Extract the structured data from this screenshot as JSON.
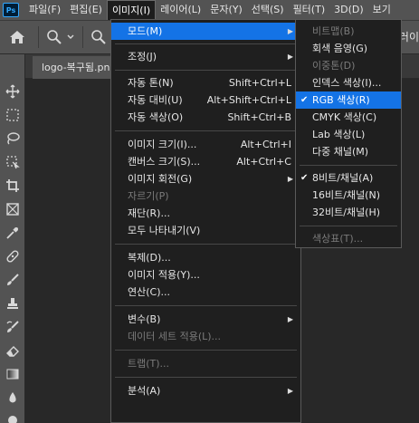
{
  "app": {
    "logo_text": "Ps"
  },
  "menubar": {
    "items": [
      {
        "label": "파일(F)"
      },
      {
        "label": "편집(E)"
      },
      {
        "label": "이미지(I)"
      },
      {
        "label": "레이어(L)"
      },
      {
        "label": "문자(Y)"
      },
      {
        "label": "선택(S)"
      },
      {
        "label": "필터(T)"
      },
      {
        "label": "3D(D)"
      },
      {
        "label": "보기"
      }
    ],
    "active_index": 2
  },
  "options": {
    "right_text": "러이"
  },
  "document_tab": {
    "title": "logo-복구됨.pn"
  },
  "image_menu": {
    "items": [
      {
        "label": "모드(M)",
        "submenu": true,
        "highlighted": true
      },
      {
        "label": "조정(J)",
        "submenu": true
      },
      {
        "label": "자동 톤(N)",
        "shortcut": "Shift+Ctrl+L"
      },
      {
        "label": "자동 대비(U)",
        "shortcut": "Alt+Shift+Ctrl+L"
      },
      {
        "label": "자동 색상(O)",
        "shortcut": "Shift+Ctrl+B"
      },
      {
        "label": "이미지 크기(I)...",
        "shortcut": "Alt+Ctrl+I"
      },
      {
        "label": "캔버스 크기(S)...",
        "shortcut": "Alt+Ctrl+C"
      },
      {
        "label": "이미지 회전(G)",
        "submenu": true
      },
      {
        "label": "자르기(P)",
        "disabled": true
      },
      {
        "label": "재단(R)..."
      },
      {
        "label": "모두 나타내기(V)"
      },
      {
        "label": "복제(D)..."
      },
      {
        "label": "이미지 적용(Y)..."
      },
      {
        "label": "연산(C)..."
      },
      {
        "label": "변수(B)",
        "submenu": true
      },
      {
        "label": "데이터 세트 적용(L)...",
        "disabled": true
      },
      {
        "label": "트랩(T)...",
        "disabled": true
      },
      {
        "label": "분석(A)",
        "submenu": true
      }
    ]
  },
  "mode_submenu": {
    "items": [
      {
        "label": "비트맵(B)",
        "disabled": true
      },
      {
        "label": "회색 음영(G)"
      },
      {
        "label": "이중톤(D)",
        "disabled": true
      },
      {
        "label": "인덱스 색상(I)..."
      },
      {
        "label": "RGB 색상(R)",
        "checked": true,
        "highlighted": true
      },
      {
        "label": "CMYK 색상(C)"
      },
      {
        "label": "Lab 색상(L)"
      },
      {
        "label": "다중 채널(M)"
      },
      {
        "label": "8비트/채널(A)",
        "checked": true
      },
      {
        "label": "16비트/채널(N)"
      },
      {
        "label": "32비트/채널(H)"
      },
      {
        "label": "색상표(T)...",
        "disabled": true
      }
    ]
  },
  "colors": {
    "highlight": "#1473e6",
    "menu_bg": "#1f1f1f",
    "ui_bg": "#535353",
    "canvas_bg": "#282828",
    "disabled_text": "#7b7b7b"
  }
}
